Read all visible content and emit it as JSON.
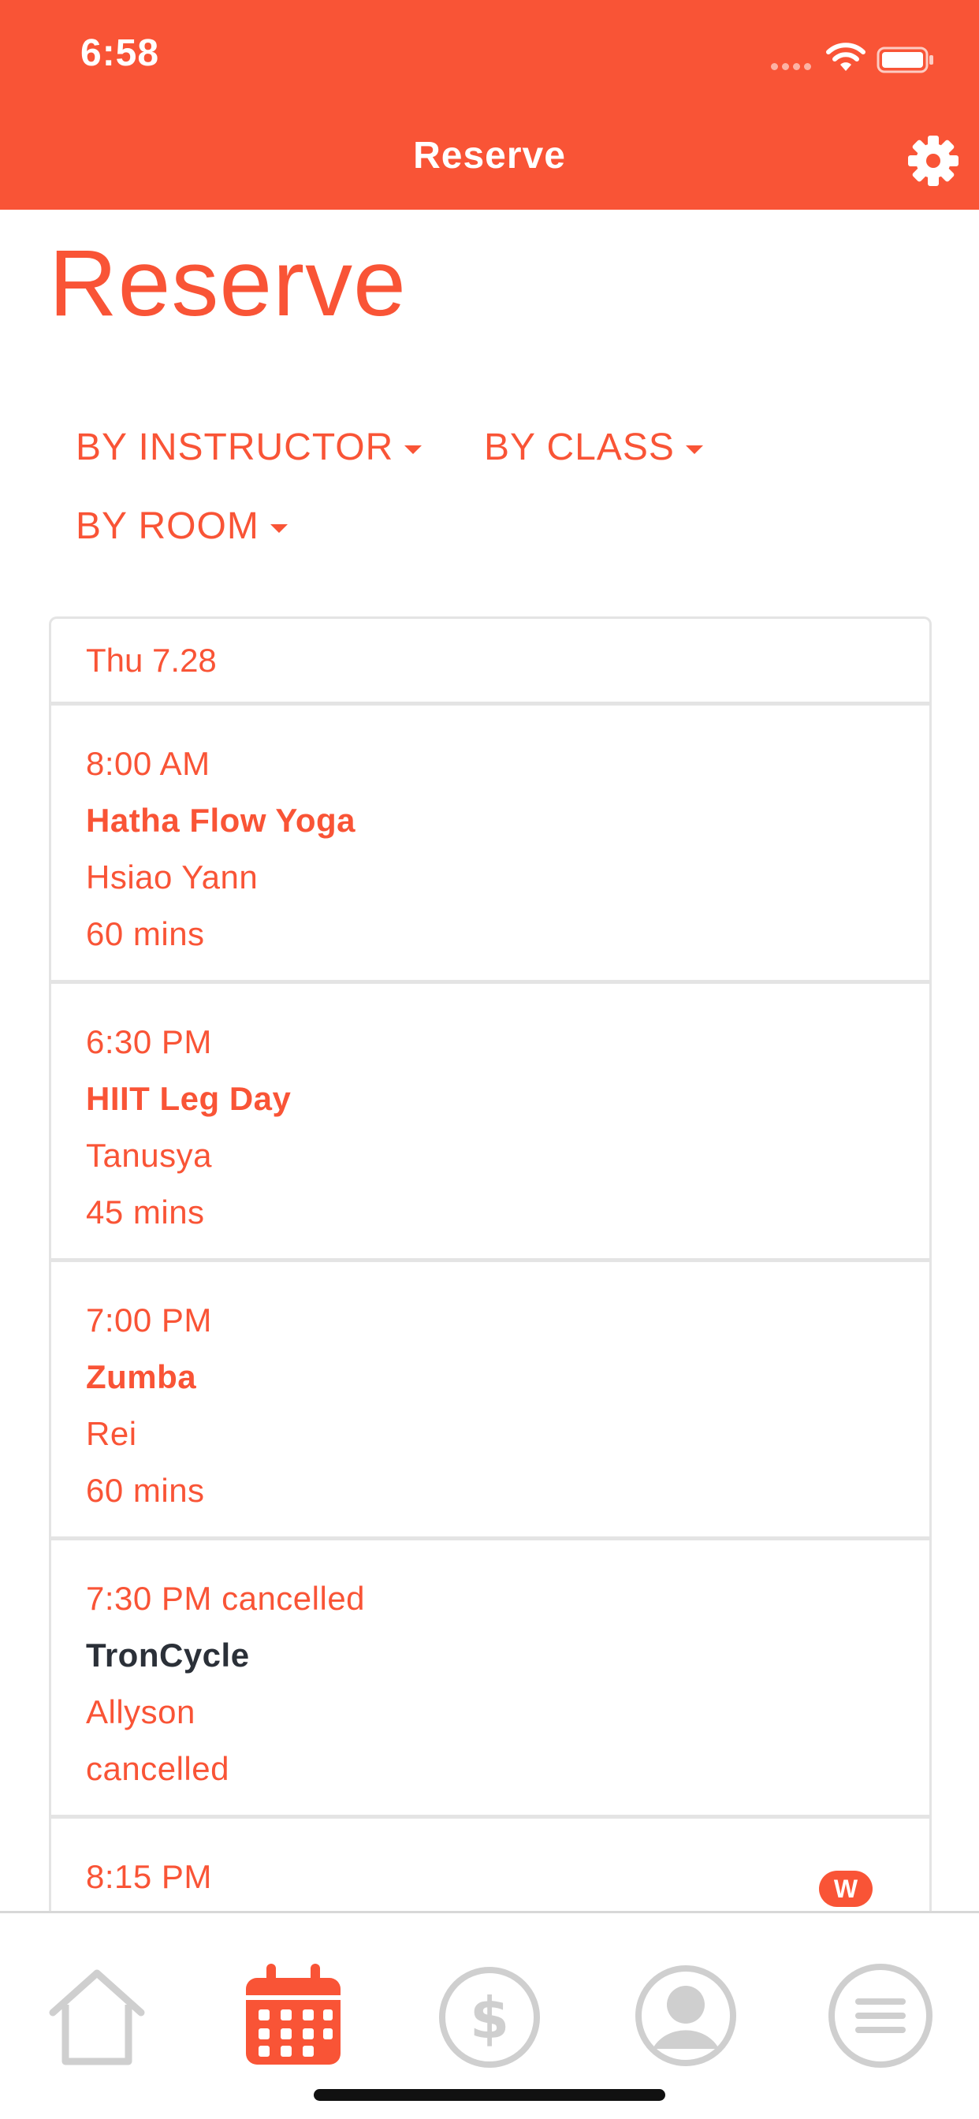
{
  "status_bar": {
    "time": "6:58"
  },
  "nav": {
    "title": "Reserve",
    "settings_icon": "gear-icon"
  },
  "page": {
    "title": "Reserve"
  },
  "filters": [
    {
      "label": "BY INSTRUCTOR"
    },
    {
      "label": "BY CLASS"
    },
    {
      "label": "BY ROOM"
    }
  ],
  "schedule": {
    "day_label": "Thu 7.28",
    "sessions": [
      {
        "time": "8:00 AM",
        "class_name": "Hatha Flow Yoga",
        "instructor": "Hsiao Yann",
        "duration": "60 mins"
      },
      {
        "time": "6:30 PM",
        "class_name": "HIIT Leg Day",
        "instructor": "Tanusya",
        "duration": "45 mins"
      },
      {
        "time": "7:00 PM",
        "class_name": "Zumba",
        "instructor": "Rei",
        "duration": "60 mins"
      },
      {
        "time": "7:30 PM cancelled",
        "class_name": "TronCycle",
        "instructor": "Allyson",
        "duration": "cancelled"
      },
      {
        "time": "8:15 PM",
        "badge": "W"
      }
    ]
  },
  "tabbar": {
    "items": [
      {
        "icon": "home-icon",
        "active": false
      },
      {
        "icon": "calendar-icon",
        "active": true
      },
      {
        "icon": "dollar-icon",
        "active": false
      },
      {
        "icon": "profile-icon",
        "active": false
      },
      {
        "icon": "menu-icon",
        "active": false
      }
    ]
  },
  "colors": {
    "accent": "#F95436",
    "inactive": "#cfcfcf",
    "dark_text": "#2b3038",
    "divider": "#e4e4e4"
  }
}
